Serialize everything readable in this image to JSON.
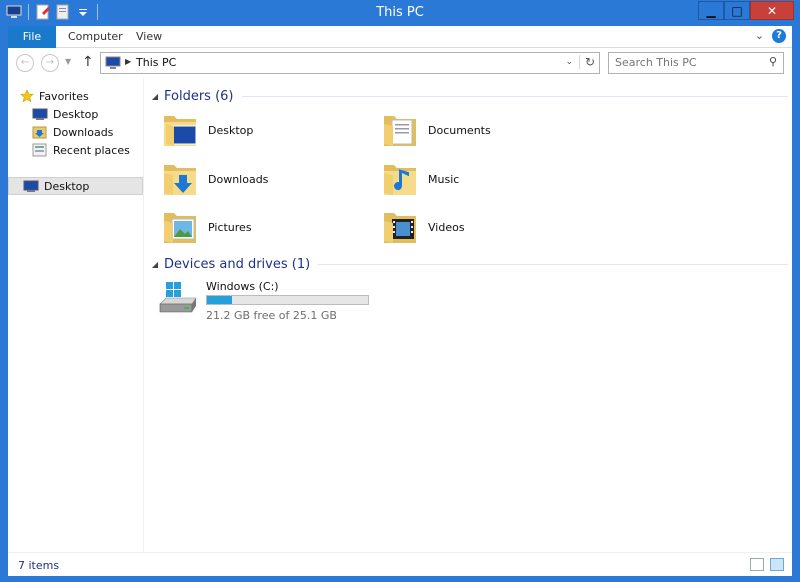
{
  "window": {
    "title": "This PC",
    "controls": {
      "minimize": "▁",
      "maximize": "□",
      "close": "✕"
    }
  },
  "ribbon": {
    "tabs": [
      {
        "label": "File"
      },
      {
        "label": "Computer"
      },
      {
        "label": "View"
      }
    ],
    "expand_icon": "chevron-down-icon",
    "help_label": "?"
  },
  "address_bar": {
    "path": "This PC",
    "search_placeholder": "Search This PC"
  },
  "navigation_pane": {
    "favorites_label": "Favorites",
    "favorites": [
      {
        "label": "Desktop"
      },
      {
        "label": "Downloads"
      },
      {
        "label": "Recent places"
      }
    ],
    "selected_label": "Desktop"
  },
  "main": {
    "folders_group": "Folders (6)",
    "folders": [
      {
        "label": "Desktop",
        "icon": "desktop-folder-icon"
      },
      {
        "label": "Documents",
        "icon": "documents-folder-icon"
      },
      {
        "label": "Downloads",
        "icon": "downloads-folder-icon"
      },
      {
        "label": "Music",
        "icon": "music-folder-icon"
      },
      {
        "label": "Pictures",
        "icon": "pictures-folder-icon"
      },
      {
        "label": "Videos",
        "icon": "videos-folder-icon"
      }
    ],
    "drives_group": "Devices and drives (1)",
    "drive": {
      "name": "Windows (C:)",
      "free_text": "21.2 GB free of 25.1 GB",
      "used_fraction": 0.155,
      "bar_color": "#26a0da"
    }
  },
  "status_bar": {
    "item_count": "7 items"
  },
  "colors": {
    "title_bar": "#2b79d6",
    "file_tab": "#1979ca",
    "group_heading": "#1e3287"
  }
}
